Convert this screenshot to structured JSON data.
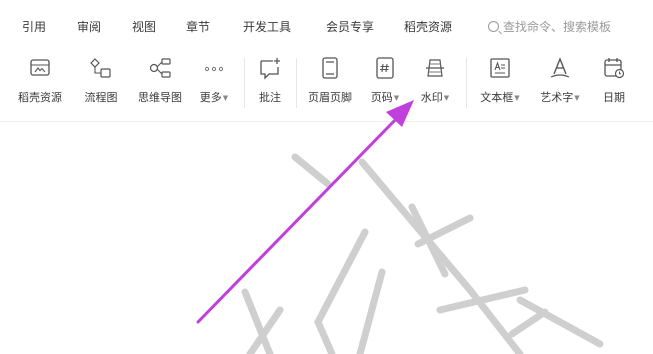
{
  "menu": {
    "items": [
      "引用",
      "审阅",
      "视图",
      "章节",
      "开发工具",
      "会员专享",
      "稻壳资源"
    ],
    "search_placeholder": "查找命令、搜索模板"
  },
  "ribbon": {
    "tools": [
      {
        "label": "稻壳资源",
        "icon": "template-icon",
        "caret": false
      },
      {
        "label": "流程图",
        "icon": "flowchart-icon",
        "caret": false
      },
      {
        "label": "思维导图",
        "icon": "mindmap-icon",
        "caret": false
      },
      {
        "label": "更多",
        "icon": "more-icon",
        "caret": true
      },
      {
        "label": "批注",
        "icon": "comment-icon",
        "caret": false
      },
      {
        "label": "页眉页脚",
        "icon": "header-footer-icon",
        "caret": false
      },
      {
        "label": "页码",
        "icon": "page-number-icon",
        "caret": true
      },
      {
        "label": "水印",
        "icon": "watermark-icon",
        "caret": true
      },
      {
        "label": "文本框",
        "icon": "textbox-icon",
        "caret": true
      },
      {
        "label": "艺术字",
        "icon": "wordart-icon",
        "caret": true
      },
      {
        "label": "日期",
        "icon": "calendar-icon",
        "caret": false
      }
    ]
  },
  "annotation": {
    "arrow_color": "#c13fdc",
    "points_to": "水印"
  },
  "watermark": {
    "color": "#cfcfcf"
  }
}
